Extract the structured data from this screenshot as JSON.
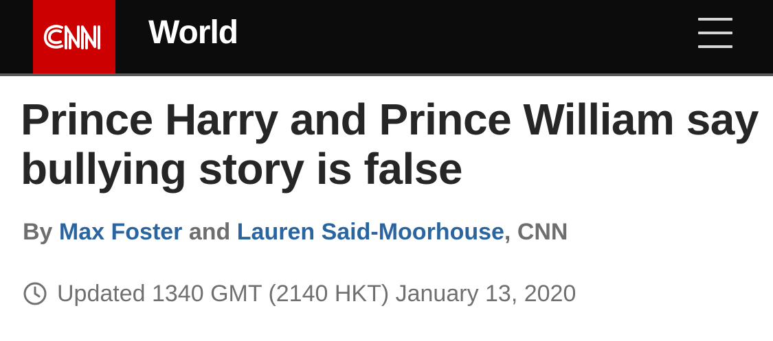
{
  "header": {
    "logo_text": "CNN",
    "section_title": "World",
    "menu_icon": "hamburger-menu-icon",
    "colors": {
      "bar_background": "#0c0c0c",
      "logo_red": "#cc0000"
    }
  },
  "article": {
    "headline": "Prince Harry and Prince William say bullying story is false",
    "byline": {
      "prefix": "By",
      "author1": "Max Foster",
      "conjunction": "and",
      "author2": "Lauren Said-Moorhouse",
      "suffix": ", CNN",
      "link_color": "#2b65a0"
    },
    "updated": {
      "icon": "clock-icon",
      "text": "Updated 1340 GMT (2140 HKT) January 13, 2020"
    }
  }
}
